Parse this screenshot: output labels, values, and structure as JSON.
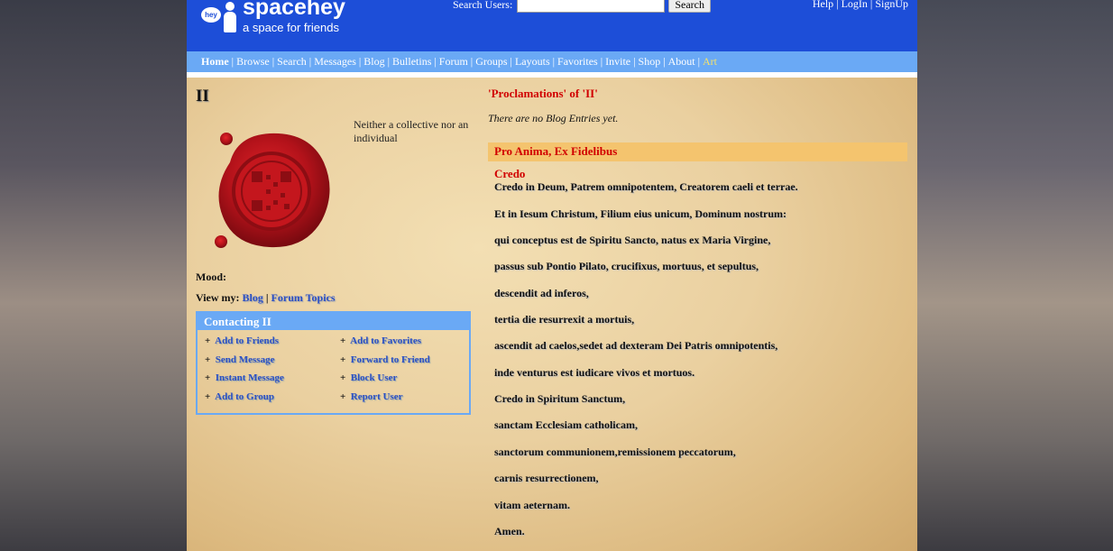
{
  "header": {
    "logo_bubble": "hey",
    "logo_text": "spacehey",
    "logo_tagline": "a space for friends",
    "search_label": "Search Users:",
    "search_value": "",
    "search_button": "Search",
    "links": [
      "Help",
      "LogIn",
      "SignUp"
    ]
  },
  "nav": {
    "items": [
      "Home",
      "Browse",
      "Search",
      "Messages",
      "Blog",
      "Bulletins",
      "Forum",
      "Groups",
      "Layouts",
      "Favorites",
      "Invite",
      "Shop",
      "About",
      "Art"
    ],
    "active": "Home"
  },
  "profile": {
    "name": "II",
    "bio": "Neither a collective nor an individual",
    "mood_label": "Mood:",
    "view_my_label": "View my:",
    "view_links": [
      "Blog",
      "Forum Topics"
    ]
  },
  "contact": {
    "title": "Contacting II",
    "actions": [
      "Add to Friends",
      "Add to Favorites",
      "Send Message",
      "Forward to Friend",
      "Instant Message",
      "Block User",
      "Add to Group",
      "Report User"
    ]
  },
  "blog": {
    "title": "'Proclamations' of 'II'",
    "empty_text": "There are no Blog Entries yet."
  },
  "blurbs": {
    "heading": "Pro Anima, Ex Fidelibus",
    "subheading": "Credo",
    "lines": [
      "Credo in Deum, Patrem omnipotentem, Creatorem caeli et terrae.",
      "Et in Iesum Christum, Filium eius unicum, Dominum nostrum:",
      "qui conceptus est de Spiritu Sancto, natus ex Maria Virgine,",
      "passus sub Pontio Pilato, crucifixus, mortuus, et sepultus,",
      "descendit ad inferos,",
      "tertia die resurrexit a mortuis,",
      "ascendit ad caelos,sedet ad dexteram Dei Patris omnipotentis,",
      "inde venturus est iudicare vivos et mortuos.",
      "Credo in Spiritum Sanctum,",
      "sanctam Ecclesiam catholicam,",
      "sanctorum communionem,remissionem peccatorum,",
      "carnis resurrectionem,",
      "vitam aeternam.",
      "Amen."
    ]
  },
  "colors": {
    "header_blue": "#1d4ed8",
    "nav_blue": "#6aa9f5",
    "accent_red": "#d10000",
    "link_blue": "#2b4fc4",
    "blurb_bar": "#f4c46e"
  }
}
